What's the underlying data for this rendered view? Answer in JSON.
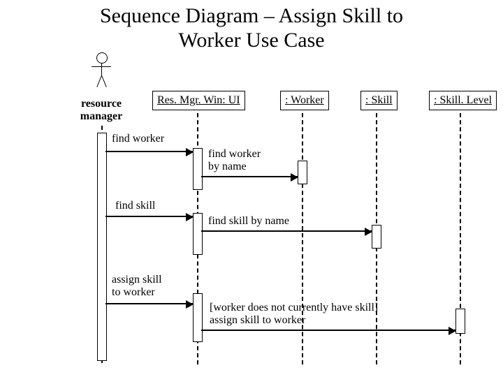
{
  "title_line1": "Sequence Diagram – Assign Skill to",
  "title_line2": "Worker Use Case",
  "actor": {
    "name": "resource manager"
  },
  "participants": {
    "ui": {
      "label": "Res. Mgr. Win: UI"
    },
    "worker": {
      "label": ": Worker"
    },
    "skill": {
      "label": ": Skill"
    },
    "level": {
      "label": ": Skill. Level"
    }
  },
  "messages": {
    "m1_trigger": "find worker",
    "m1_call": "find worker\nby name",
    "m2_trigger": "find skill",
    "m2_call": "find skill by name",
    "m3_trigger": "assign skill\nto worker",
    "m3_call": "[worker does not currently have skill]\nassign skill to worker"
  },
  "chart_data": {
    "type": "sequence-diagram",
    "actor": "resource manager",
    "participants": [
      "Res. Mgr. Win: UI",
      ": Worker",
      ": Skill",
      ": Skill. Level"
    ],
    "interactions": [
      {
        "from": "resource manager",
        "to": "Res. Mgr. Win: UI",
        "label": "find worker"
      },
      {
        "from": "Res. Mgr. Win: UI",
        "to": ": Worker",
        "label": "find worker by name"
      },
      {
        "from": "resource manager",
        "to": "Res. Mgr. Win: UI",
        "label": "find skill"
      },
      {
        "from": "Res. Mgr. Win: UI",
        "to": ": Skill",
        "label": "find skill by name"
      },
      {
        "from": "resource manager",
        "to": "Res. Mgr. Win: UI",
        "label": "assign skill to worker"
      },
      {
        "from": "Res. Mgr. Win: UI",
        "to": ": Skill. Level",
        "label": "[worker does not currently have skill] assign skill to worker"
      }
    ]
  }
}
